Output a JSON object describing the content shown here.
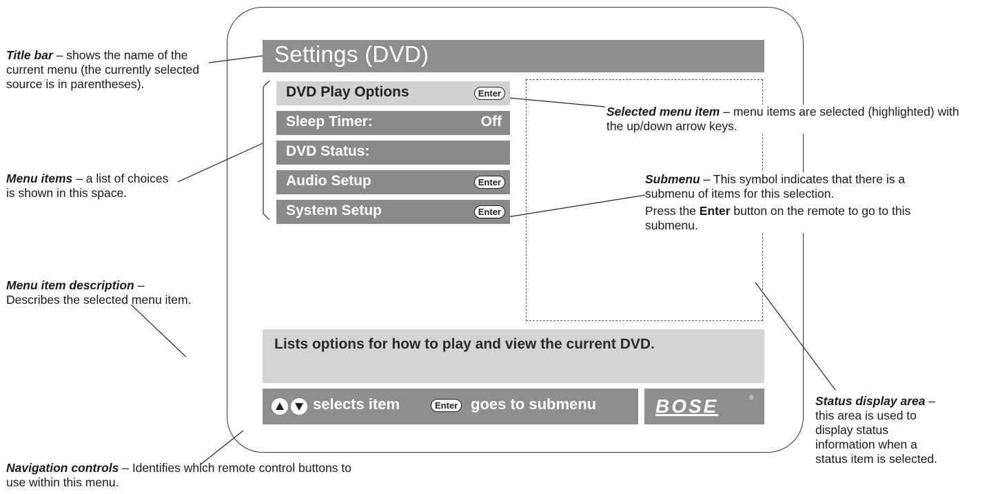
{
  "screen": {
    "title": "Settings (DVD)",
    "menu_items": [
      {
        "label": "DVD Play Options",
        "value": "",
        "enter": "Enter",
        "selected": true
      },
      {
        "label": "Sleep Timer:",
        "value": "Off",
        "enter": "",
        "selected": false
      },
      {
        "label": "DVD Status:",
        "value": "",
        "enter": "",
        "selected": false
      },
      {
        "label": "Audio Setup",
        "value": "",
        "enter": "Enter",
        "selected": false
      },
      {
        "label": "System Setup",
        "value": "",
        "enter": "Enter",
        "selected": false
      }
    ],
    "description": "Lists options for how to play and view the current DVD.",
    "nav": {
      "selects_text": "selects item",
      "enter_label": "Enter",
      "goes_text": "goes to submenu"
    },
    "logo": "BOSE",
    "logo_mark": "®"
  },
  "annotations": {
    "title_bar": {
      "term": "Title bar",
      "text": " – shows the name of the current menu (the currently selected source is in parentheses)."
    },
    "menu_items": {
      "term": "Menu items",
      "text": " – a list of choices is shown in this space."
    },
    "menu_item_description": {
      "term": "Menu item description",
      "text": " – Describes the selected menu item."
    },
    "navigation_controls": {
      "term": "Navigation controls",
      "text": " – Identifies which remote control buttons to use within this menu."
    },
    "selected_menu_item": {
      "term": "Selected menu item",
      "text": " – menu items are selected (highlighted) with the up/down arrow keys."
    },
    "submenu": {
      "term": "Submenu",
      "text": " – This symbol indicates that there is a submenu of items for this selection.",
      "press_before": "Press the ",
      "press_key": "Enter",
      "press_after": " button on the remote to go to this submenu."
    },
    "status_display_area": {
      "term": "Status display area",
      "text": " – this area is used to display status information when a status item is selected."
    }
  }
}
